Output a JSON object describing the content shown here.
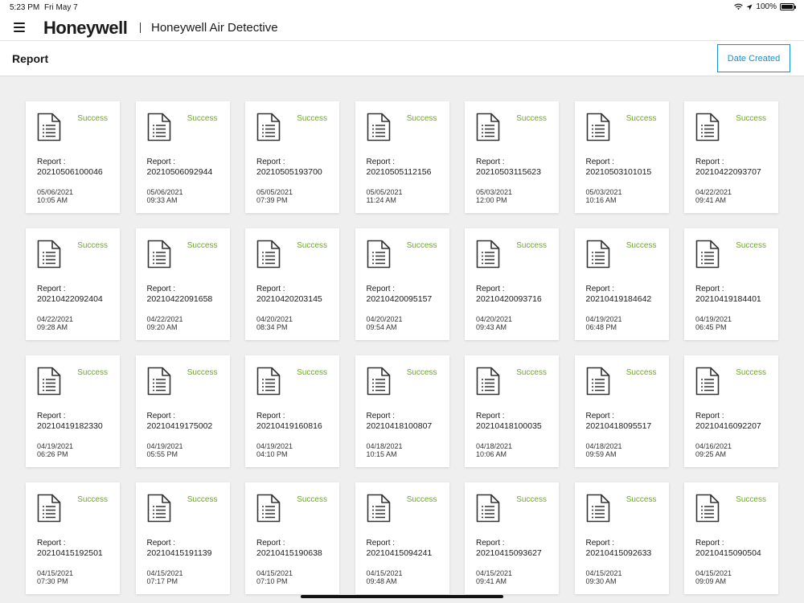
{
  "status_bar": {
    "time": "5:23 PM",
    "date": "Fri May 7",
    "battery": "100%"
  },
  "app": {
    "brand": "Honeywell",
    "title": "Honeywell Air Detective"
  },
  "page": {
    "title": "Report",
    "sort_button": "Date Created"
  },
  "report_label": "Report :",
  "reports": [
    {
      "id": "20210506100046",
      "status": "Success",
      "date": "05/06/2021",
      "time": "10:05 AM"
    },
    {
      "id": "20210506092944",
      "status": "Success",
      "date": "05/06/2021",
      "time": "09:33 AM"
    },
    {
      "id": "20210505193700",
      "status": "Success",
      "date": "05/05/2021",
      "time": "07:39 PM"
    },
    {
      "id": "20210505112156",
      "status": "Success",
      "date": "05/05/2021",
      "time": "11:24 AM"
    },
    {
      "id": "20210503115623",
      "status": "Success",
      "date": "05/03/2021",
      "time": "12:00 PM"
    },
    {
      "id": "20210503101015",
      "status": "Success",
      "date": "05/03/2021",
      "time": "10:16 AM"
    },
    {
      "id": "20210422093707",
      "status": "Success",
      "date": "04/22/2021",
      "time": "09:41 AM"
    },
    {
      "id": "20210422092404",
      "status": "Success",
      "date": "04/22/2021",
      "time": "09:28 AM"
    },
    {
      "id": "20210422091658",
      "status": "Success",
      "date": "04/22/2021",
      "time": "09:20 AM"
    },
    {
      "id": "20210420203145",
      "status": "Success",
      "date": "04/20/2021",
      "time": "08:34 PM"
    },
    {
      "id": "20210420095157",
      "status": "Success",
      "date": "04/20/2021",
      "time": "09:54 AM"
    },
    {
      "id": "20210420093716",
      "status": "Success",
      "date": "04/20/2021",
      "time": "09:43 AM"
    },
    {
      "id": "20210419184642",
      "status": "Success",
      "date": "04/19/2021",
      "time": "06:48 PM"
    },
    {
      "id": "20210419184401",
      "status": "Success",
      "date": "04/19/2021",
      "time": "06:45 PM"
    },
    {
      "id": "20210419182330",
      "status": "Success",
      "date": "04/19/2021",
      "time": "06:26 PM"
    },
    {
      "id": "20210419175002",
      "status": "Success",
      "date": "04/19/2021",
      "time": "05:55 PM"
    },
    {
      "id": "20210419160816",
      "status": "Success",
      "date": "04/19/2021",
      "time": "04:10 PM"
    },
    {
      "id": "20210418100807",
      "status": "Success",
      "date": "04/18/2021",
      "time": "10:15 AM"
    },
    {
      "id": "20210418100035",
      "status": "Success",
      "date": "04/18/2021",
      "time": "10:06 AM"
    },
    {
      "id": "20210418095517",
      "status": "Success",
      "date": "04/18/2021",
      "time": "09:59 AM"
    },
    {
      "id": "20210416092207",
      "status": "Success",
      "date": "04/16/2021",
      "time": "09:25 AM"
    },
    {
      "id": "20210415192501",
      "status": "Success",
      "date": "04/15/2021",
      "time": "07:30 PM"
    },
    {
      "id": "20210415191139",
      "status": "Success",
      "date": "04/15/2021",
      "time": "07:17 PM"
    },
    {
      "id": "20210415190638",
      "status": "Success",
      "date": "04/15/2021",
      "time": "07:10 PM"
    },
    {
      "id": "20210415094241",
      "status": "Success",
      "date": "04/15/2021",
      "time": "09:48 AM"
    },
    {
      "id": "20210415093627",
      "status": "Success",
      "date": "04/15/2021",
      "time": "09:41 AM"
    },
    {
      "id": "20210415092633",
      "status": "Success",
      "date": "04/15/2021",
      "time": "09:30 AM"
    },
    {
      "id": "20210415090504",
      "status": "Success",
      "date": "04/15/2021",
      "time": "09:09 AM"
    }
  ],
  "colors": {
    "success": "#6aaa1e",
    "accent": "#1a8fc7"
  },
  "icons": {
    "menu": "hamburger-menu-icon",
    "report": "document-icon",
    "wifi": "wifi-icon",
    "location": "location-arrow-icon",
    "battery": "battery-icon"
  }
}
